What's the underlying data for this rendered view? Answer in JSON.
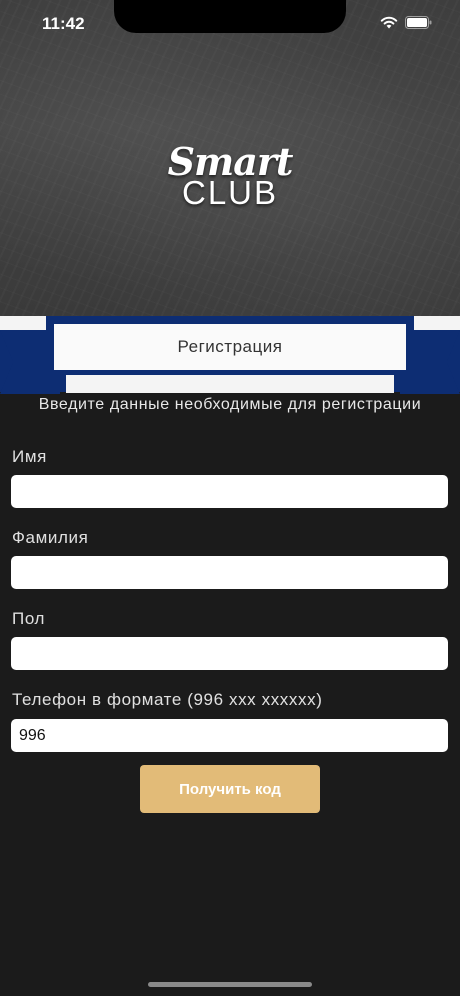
{
  "status_bar": {
    "time": "11:42"
  },
  "header": {
    "logo_line1": "Smart",
    "logo_line2": "CLUB"
  },
  "ribbon": {
    "title": "Регистрация"
  },
  "form": {
    "subtitle": "Введите данные необходимые для регистрации",
    "fields": [
      {
        "label": "Имя",
        "value": "",
        "placeholder": ""
      },
      {
        "label": "Фамилия",
        "value": "",
        "placeholder": ""
      },
      {
        "label": "Пол",
        "value": "",
        "placeholder": ""
      },
      {
        "label": "Телефон в формате (996 xxx xxxxxx)",
        "value": "996",
        "placeholder": ""
      }
    ],
    "submit_label": "Получить код"
  },
  "colors": {
    "background": "#1b1b1b",
    "ribbon_blue": "#0d2d73",
    "button_gold": "#e2bb78"
  }
}
